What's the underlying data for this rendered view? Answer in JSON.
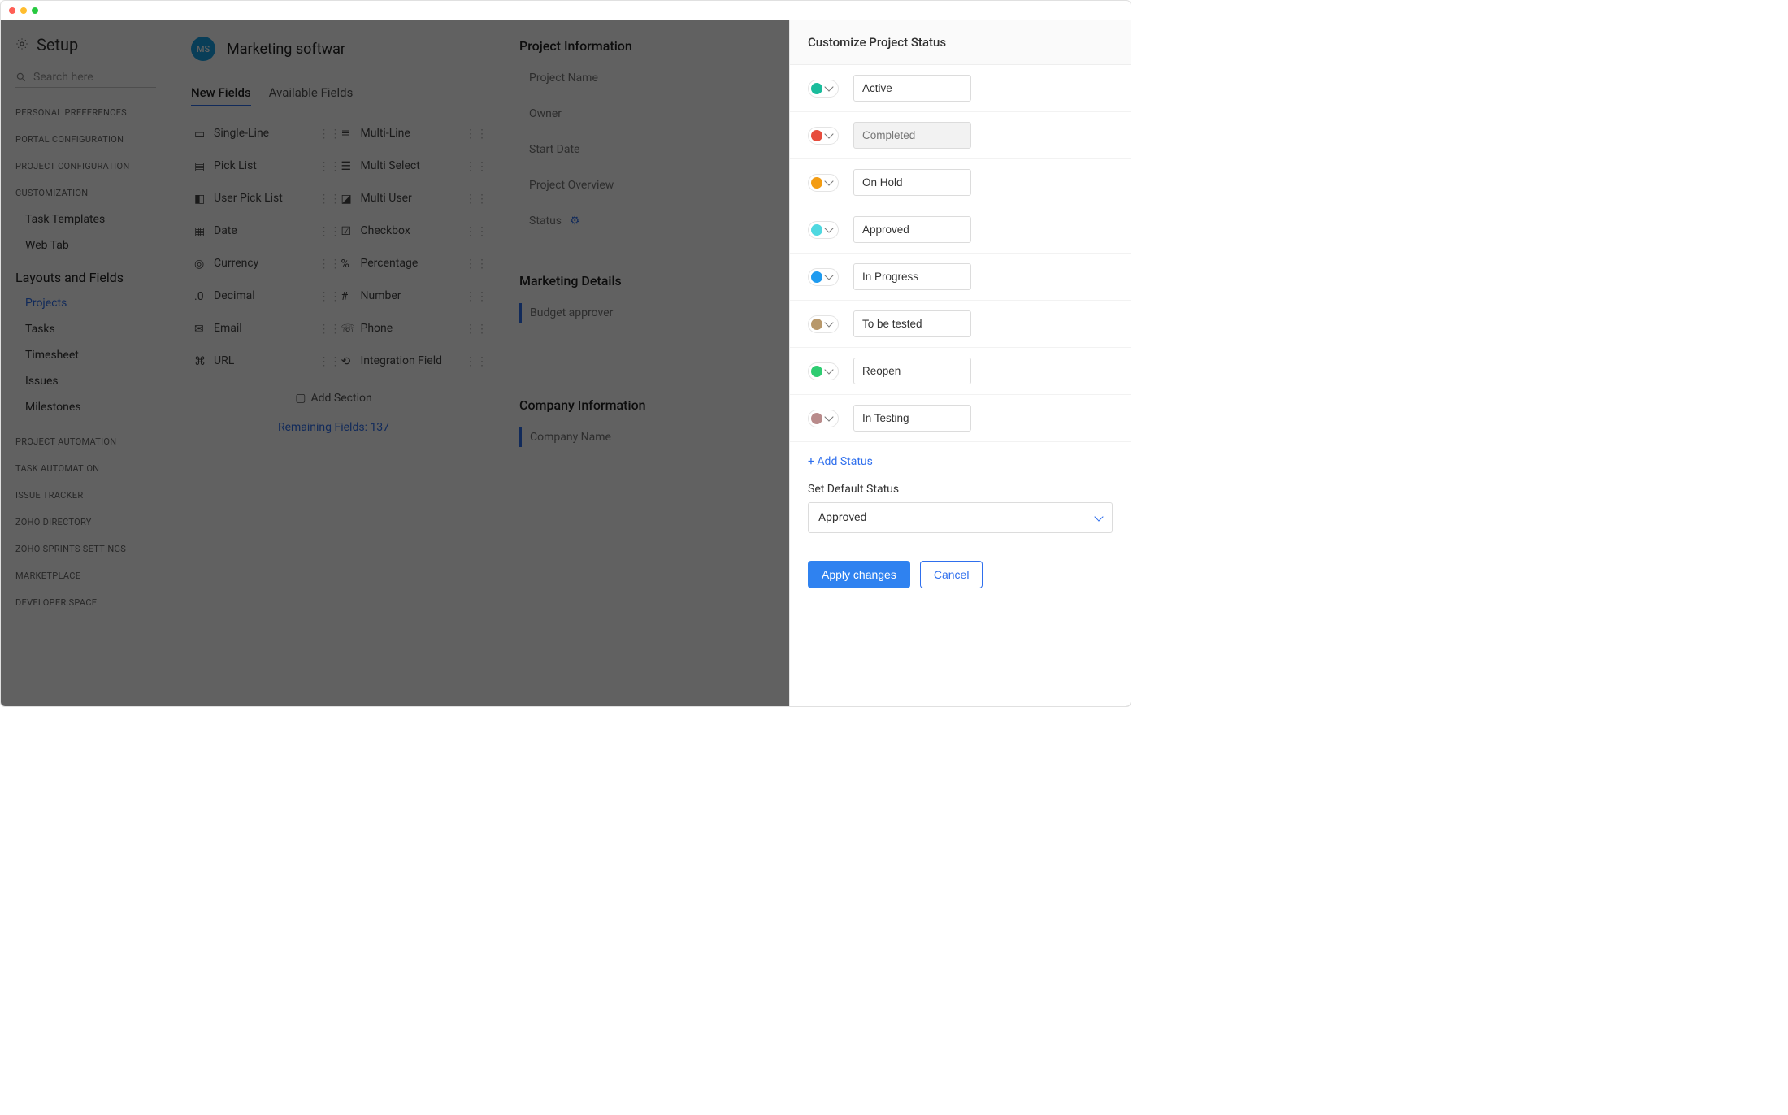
{
  "window": {},
  "setup": {
    "title": "Setup",
    "search_placeholder": "Search here"
  },
  "sidebar": {
    "groups": [
      {
        "label": "PERSONAL PREFERENCES"
      },
      {
        "label": "PORTAL CONFIGURATION"
      },
      {
        "label": "PROJECT CONFIGURATION"
      },
      {
        "label": "CUSTOMIZATION"
      }
    ],
    "customization_items": [
      {
        "label": "Task Templates"
      },
      {
        "label": "Web Tab"
      }
    ],
    "layouts_heading": "Layouts and Fields",
    "layouts_items": [
      {
        "label": "Projects",
        "active": true
      },
      {
        "label": "Tasks"
      },
      {
        "label": "Timesheet"
      },
      {
        "label": "Issues"
      },
      {
        "label": "Milestones"
      }
    ],
    "trailing_groups": [
      {
        "label": "PROJECT AUTOMATION"
      },
      {
        "label": "TASK AUTOMATION"
      },
      {
        "label": "ISSUE TRACKER"
      },
      {
        "label": "ZOHO DIRECTORY"
      },
      {
        "label": "ZOHO SPRINTS SETTINGS"
      },
      {
        "label": "MARKETPLACE"
      },
      {
        "label": "DEVELOPER SPACE"
      }
    ]
  },
  "project": {
    "avatar_initials": "MS",
    "name": "Marketing softwar"
  },
  "tabs": {
    "new": "New Fields",
    "available": "Available Fields"
  },
  "fields_left": [
    {
      "label": "Single-Line"
    },
    {
      "label": "Pick List"
    },
    {
      "label": "User Pick List"
    },
    {
      "label": "Date"
    },
    {
      "label": "Currency"
    },
    {
      "label": "Decimal"
    },
    {
      "label": "Email"
    },
    {
      "label": "URL"
    }
  ],
  "fields_right": [
    {
      "label": "Multi-Line"
    },
    {
      "label": "Multi Select"
    },
    {
      "label": "Multi User"
    },
    {
      "label": "Checkbox"
    },
    {
      "label": "Percentage"
    },
    {
      "label": "Number"
    },
    {
      "label": "Phone"
    },
    {
      "label": "Integration Field"
    }
  ],
  "add_section": "Add Section",
  "remaining": "Remaining Fields: 137",
  "info": {
    "section1": "Project Information",
    "rows1": [
      "Project Name",
      "Owner",
      "Start Date",
      "Project Overview"
    ],
    "status_label": "Status",
    "section2": "Marketing Details",
    "budget_approver": "Budget approver",
    "section3": "Company Information",
    "company_name": "Company Name"
  },
  "panel": {
    "title": "Customize Project Status",
    "statuses": [
      {
        "label": "Active",
        "color": "#1abc9c",
        "readonly": false
      },
      {
        "label": "Completed",
        "color": "#e74c3c",
        "readonly": true
      },
      {
        "label": "On Hold",
        "color": "#f39c12",
        "readonly": false
      },
      {
        "label": "Approved",
        "color": "#4fd8e0",
        "readonly": false
      },
      {
        "label": "In Progress",
        "color": "#1e9bf0",
        "readonly": false
      },
      {
        "label": "To be tested",
        "color": "#b8986a",
        "readonly": false
      },
      {
        "label": "Reopen",
        "color": "#2ecc71",
        "readonly": false
      },
      {
        "label": "In Testing",
        "color": "#b98b8b",
        "readonly": false
      }
    ],
    "add_status": "+ Add Status",
    "default_label": "Set Default Status",
    "default_value": "Approved",
    "apply": "Apply changes",
    "cancel": "Cancel"
  }
}
